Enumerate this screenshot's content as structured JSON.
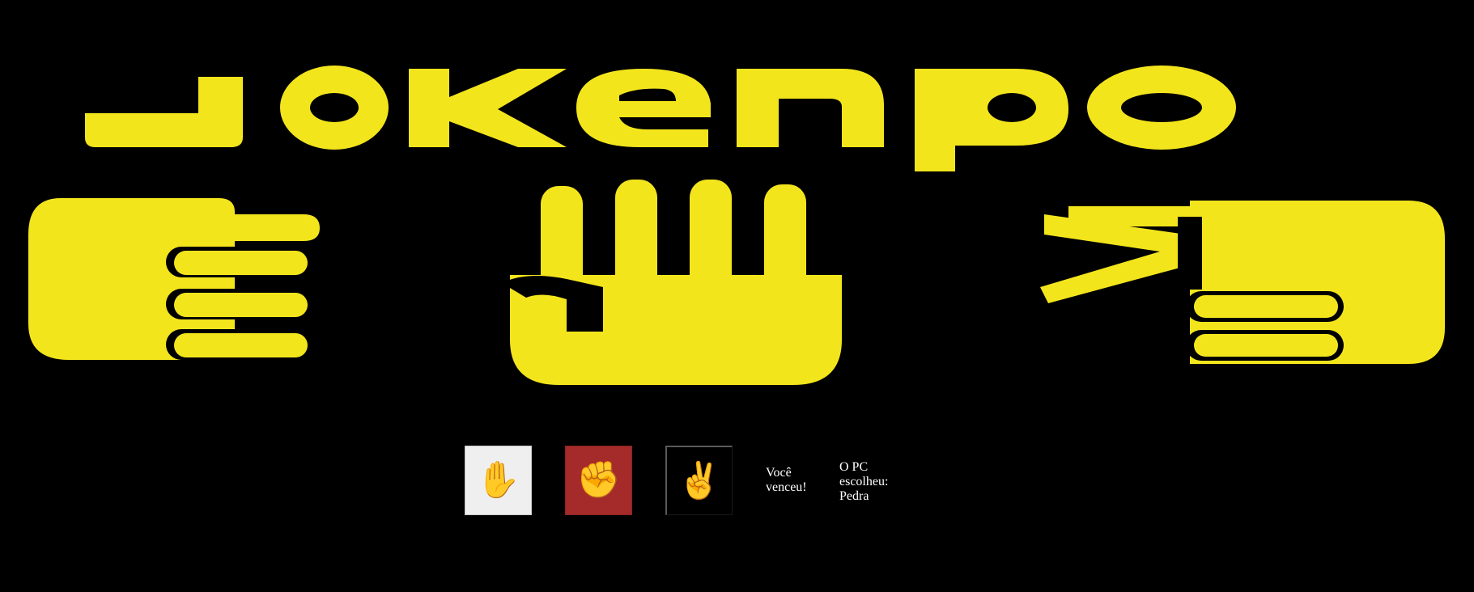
{
  "banner": {
    "logo_text": "JOKENPO",
    "colors": {
      "background": "#000000",
      "logo_yellow": "#f3e51c"
    },
    "hand_icons": [
      "fist-icon",
      "open-hand-icon",
      "scissors-hand-icon"
    ]
  },
  "buttons": {
    "paper": {
      "icon": "✋",
      "icon_name": "raised-hand-icon",
      "color": "#efefef"
    },
    "rock": {
      "icon": "✊",
      "icon_name": "raised-fist-icon",
      "color": "#a52a2a"
    },
    "scissors": {
      "icon": "✌️",
      "icon_name": "victory-hand-icon",
      "color": "#000000"
    }
  },
  "result": {
    "line1": "Você",
    "line2": "venceu!"
  },
  "pc_choice": {
    "line1": "O PC",
    "line2": "escolheu:",
    "line3": "Pedra"
  }
}
